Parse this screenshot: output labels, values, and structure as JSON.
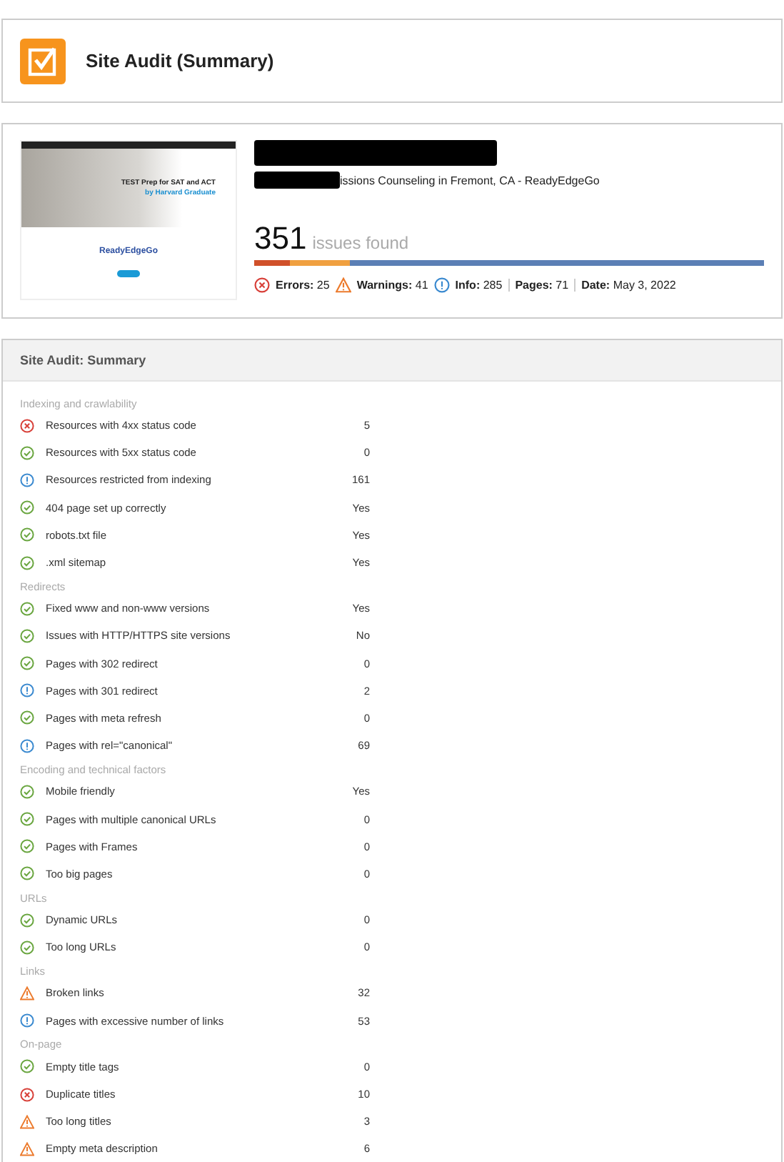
{
  "header": {
    "title": "Site Audit (Summary)"
  },
  "site": {
    "thumbnail": {
      "headline": "TEST Prep for SAT and ACT",
      "subline": "by Harvard Graduate",
      "brand": "ReadyEdgeGo"
    },
    "subtitle": "issions Counseling in Fremont, CA - ReadyEdgeGo",
    "issues_count": "351",
    "issues_label": "issues found",
    "bar": [
      {
        "color": "#d0502a"
      },
      {
        "color": "#f0a040"
      },
      {
        "color": "#5b7fb5"
      }
    ],
    "stats": [
      {
        "kind": "error",
        "label": "Errors:",
        "value": "25"
      },
      {
        "kind": "warning",
        "label": "Warnings:",
        "value": "41"
      },
      {
        "kind": "info",
        "label": "Info:",
        "value": "285"
      },
      {
        "kind": "plain",
        "label": "Pages:",
        "value": "71"
      },
      {
        "kind": "plain",
        "label": "Date:",
        "value": "May 3, 2022"
      }
    ]
  },
  "summary": {
    "title": "Site Audit: Summary",
    "sections": [
      {
        "heading": "Indexing and crawlability",
        "rows": [
          {
            "kind": "error",
            "label": "Resources with 4xx status code",
            "value": "5"
          },
          {
            "kind": "ok",
            "label": "Resources with 5xx status code",
            "value": "0"
          },
          {
            "kind": "info",
            "label": "Resources restricted from indexing",
            "value": "161"
          },
          {
            "kind": "ok",
            "label": "404 page set up correctly",
            "value": "Yes"
          },
          {
            "kind": "ok",
            "label": "robots.txt file",
            "value": "Yes"
          },
          {
            "kind": "ok",
            "label": ".xml sitemap",
            "value": "Yes"
          }
        ]
      },
      {
        "heading": "Redirects",
        "rows": [
          {
            "kind": "ok",
            "label": "Fixed www and non-www versions",
            "value": "Yes"
          },
          {
            "kind": "ok",
            "label": "Issues with HTTP/HTTPS site versions",
            "value": "No"
          },
          {
            "kind": "ok",
            "label": "Pages with 302 redirect",
            "value": "0"
          },
          {
            "kind": "info",
            "label": "Pages with 301 redirect",
            "value": "2"
          },
          {
            "kind": "ok",
            "label": "Pages with meta refresh",
            "value": "0"
          },
          {
            "kind": "info",
            "label": "Pages with rel=\"canonical\"",
            "value": "69"
          }
        ]
      },
      {
        "heading": "Encoding and technical factors",
        "rows": [
          {
            "kind": "ok",
            "label": "Mobile friendly",
            "value": "Yes"
          },
          {
            "kind": "ok",
            "label": "Pages with multiple canonical URLs",
            "value": "0"
          },
          {
            "kind": "ok",
            "label": "Pages with Frames",
            "value": "0"
          },
          {
            "kind": "ok",
            "label": "Too big pages",
            "value": "0"
          }
        ]
      },
      {
        "heading": "URLs",
        "rows": [
          {
            "kind": "ok",
            "label": "Dynamic URLs",
            "value": "0"
          },
          {
            "kind": "ok",
            "label": "Too long URLs",
            "value": "0"
          }
        ]
      },
      {
        "heading": "Links",
        "rows": [
          {
            "kind": "warning",
            "label": "Broken links",
            "value": "32"
          },
          {
            "kind": "info",
            "label": "Pages with excessive number of links",
            "value": "53"
          }
        ]
      },
      {
        "heading": "On-page",
        "rows": [
          {
            "kind": "ok",
            "label": "Empty title tags",
            "value": "0"
          },
          {
            "kind": "error",
            "label": "Duplicate titles",
            "value": "10"
          },
          {
            "kind": "warning",
            "label": "Too long titles",
            "value": "3"
          },
          {
            "kind": "warning",
            "label": "Empty meta description",
            "value": "6"
          }
        ]
      }
    ]
  }
}
